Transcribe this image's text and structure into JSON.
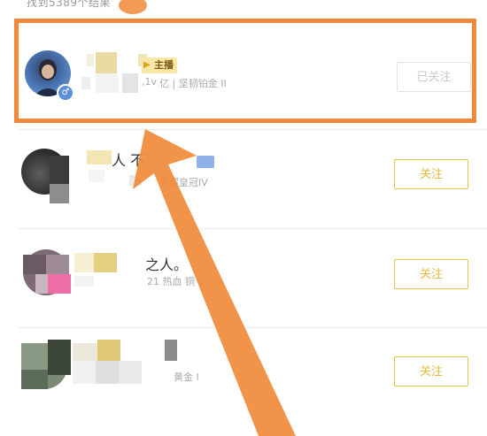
{
  "search": {
    "result_count_text": "找到5389个结果"
  },
  "results": [
    {
      "name_partial": "",
      "tag_label": "主播",
      "sub_text": "亿 | 坚韧铂金 II",
      "sub_prefix": ",1v",
      "follow_label": "已关注",
      "followed": true
    },
    {
      "name_partial": "人 不",
      "sub_text": "荣耀皇冠IV",
      "follow_label": "关注",
      "followed": false
    },
    {
      "name_partial": "之人。",
      "sub_text": "21 热血   铜 V",
      "follow_label": "关注",
      "followed": false
    },
    {
      "name_partial": "",
      "sub_text": "黄金 I",
      "follow_label": "关注",
      "followed": false
    }
  ],
  "colors": {
    "highlight": "#f08a3a",
    "follow_border": "#e6c34a",
    "follow_text": "#e6b93a",
    "followed_text": "#c9c9c9",
    "gender_male": "#5b8fd8"
  },
  "icons": {
    "gender": "male-gender-icon",
    "tag": "anchor-tag-icon",
    "level": "level-badge-icon"
  }
}
